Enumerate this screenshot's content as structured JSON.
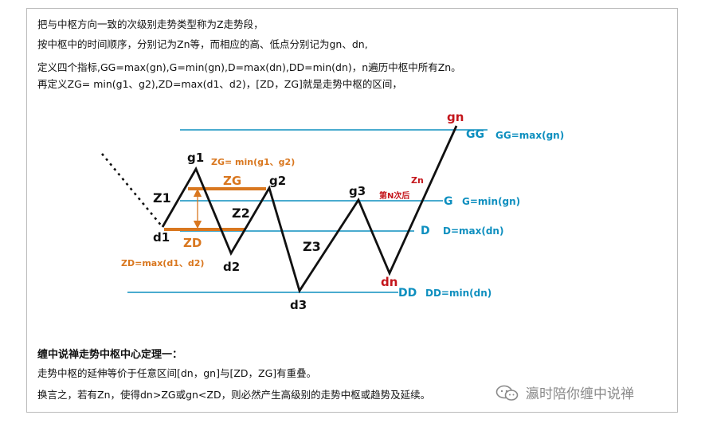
{
  "intro_lines": [
    "把与中枢方向一致的次级别走势类型称为Z走势段，",
    "按中枢中的时间顺序，分别记为Zn等，而相应的高、低点分别记为gn、dn,",
    "定义四个指标,GG=max(gn),G=min(gn),D=max(dn),DD=min(dn)，n遍历中枢中所有Zn。",
    "再定义ZG= min(g1、g2),ZD=max(d1、d2)，[ZD，ZG]就是走势中枢的区间，"
  ],
  "diagram": {
    "levels": {
      "GG": {
        "short": "GG",
        "formula": "GG=max(gn)",
        "color": "#0e8fbf"
      },
      "G": {
        "short": "G",
        "formula": "G=min(gn)",
        "color": "#0e8fbf"
      },
      "D": {
        "short": "D",
        "formula": "D=max(dn)",
        "color": "#0e8fbf"
      },
      "DD": {
        "short": "DD",
        "formula": "DD=min(dn)",
        "color": "#0e8fbf"
      }
    },
    "zone": {
      "zg": "ZG",
      "zd": "ZD",
      "zg_def": "ZG= min(g1、g2)",
      "zd_def": "ZD=max(d1、d2)",
      "color": "#d9771f"
    },
    "points": {
      "g1": "g1",
      "g2": "g2",
      "g3": "g3",
      "d1": "d1",
      "d2": "d2",
      "d3": "d3",
      "gn": "gn",
      "dn": "dn"
    },
    "segments": {
      "z1": "Z1",
      "z2": "Z2",
      "z3": "Z3",
      "zn": "Zn",
      "nth": "第N次后"
    },
    "accent_red": "#c4161c"
  },
  "theorem": {
    "title": "缠中说禅走势中枢中心定理一：",
    "lines": [
      "走势中枢的延伸等价于任意区间[dn，gn]与[ZD，ZG]有重叠。",
      "换言之，若有Zn，使得dn>ZG或gn<ZD，则必然产生高级别的走势中枢或趋势及延续。"
    ]
  },
  "watermark": {
    "text": "瀛时陪你缠中说禅",
    "icon": "wechat-icon"
  }
}
